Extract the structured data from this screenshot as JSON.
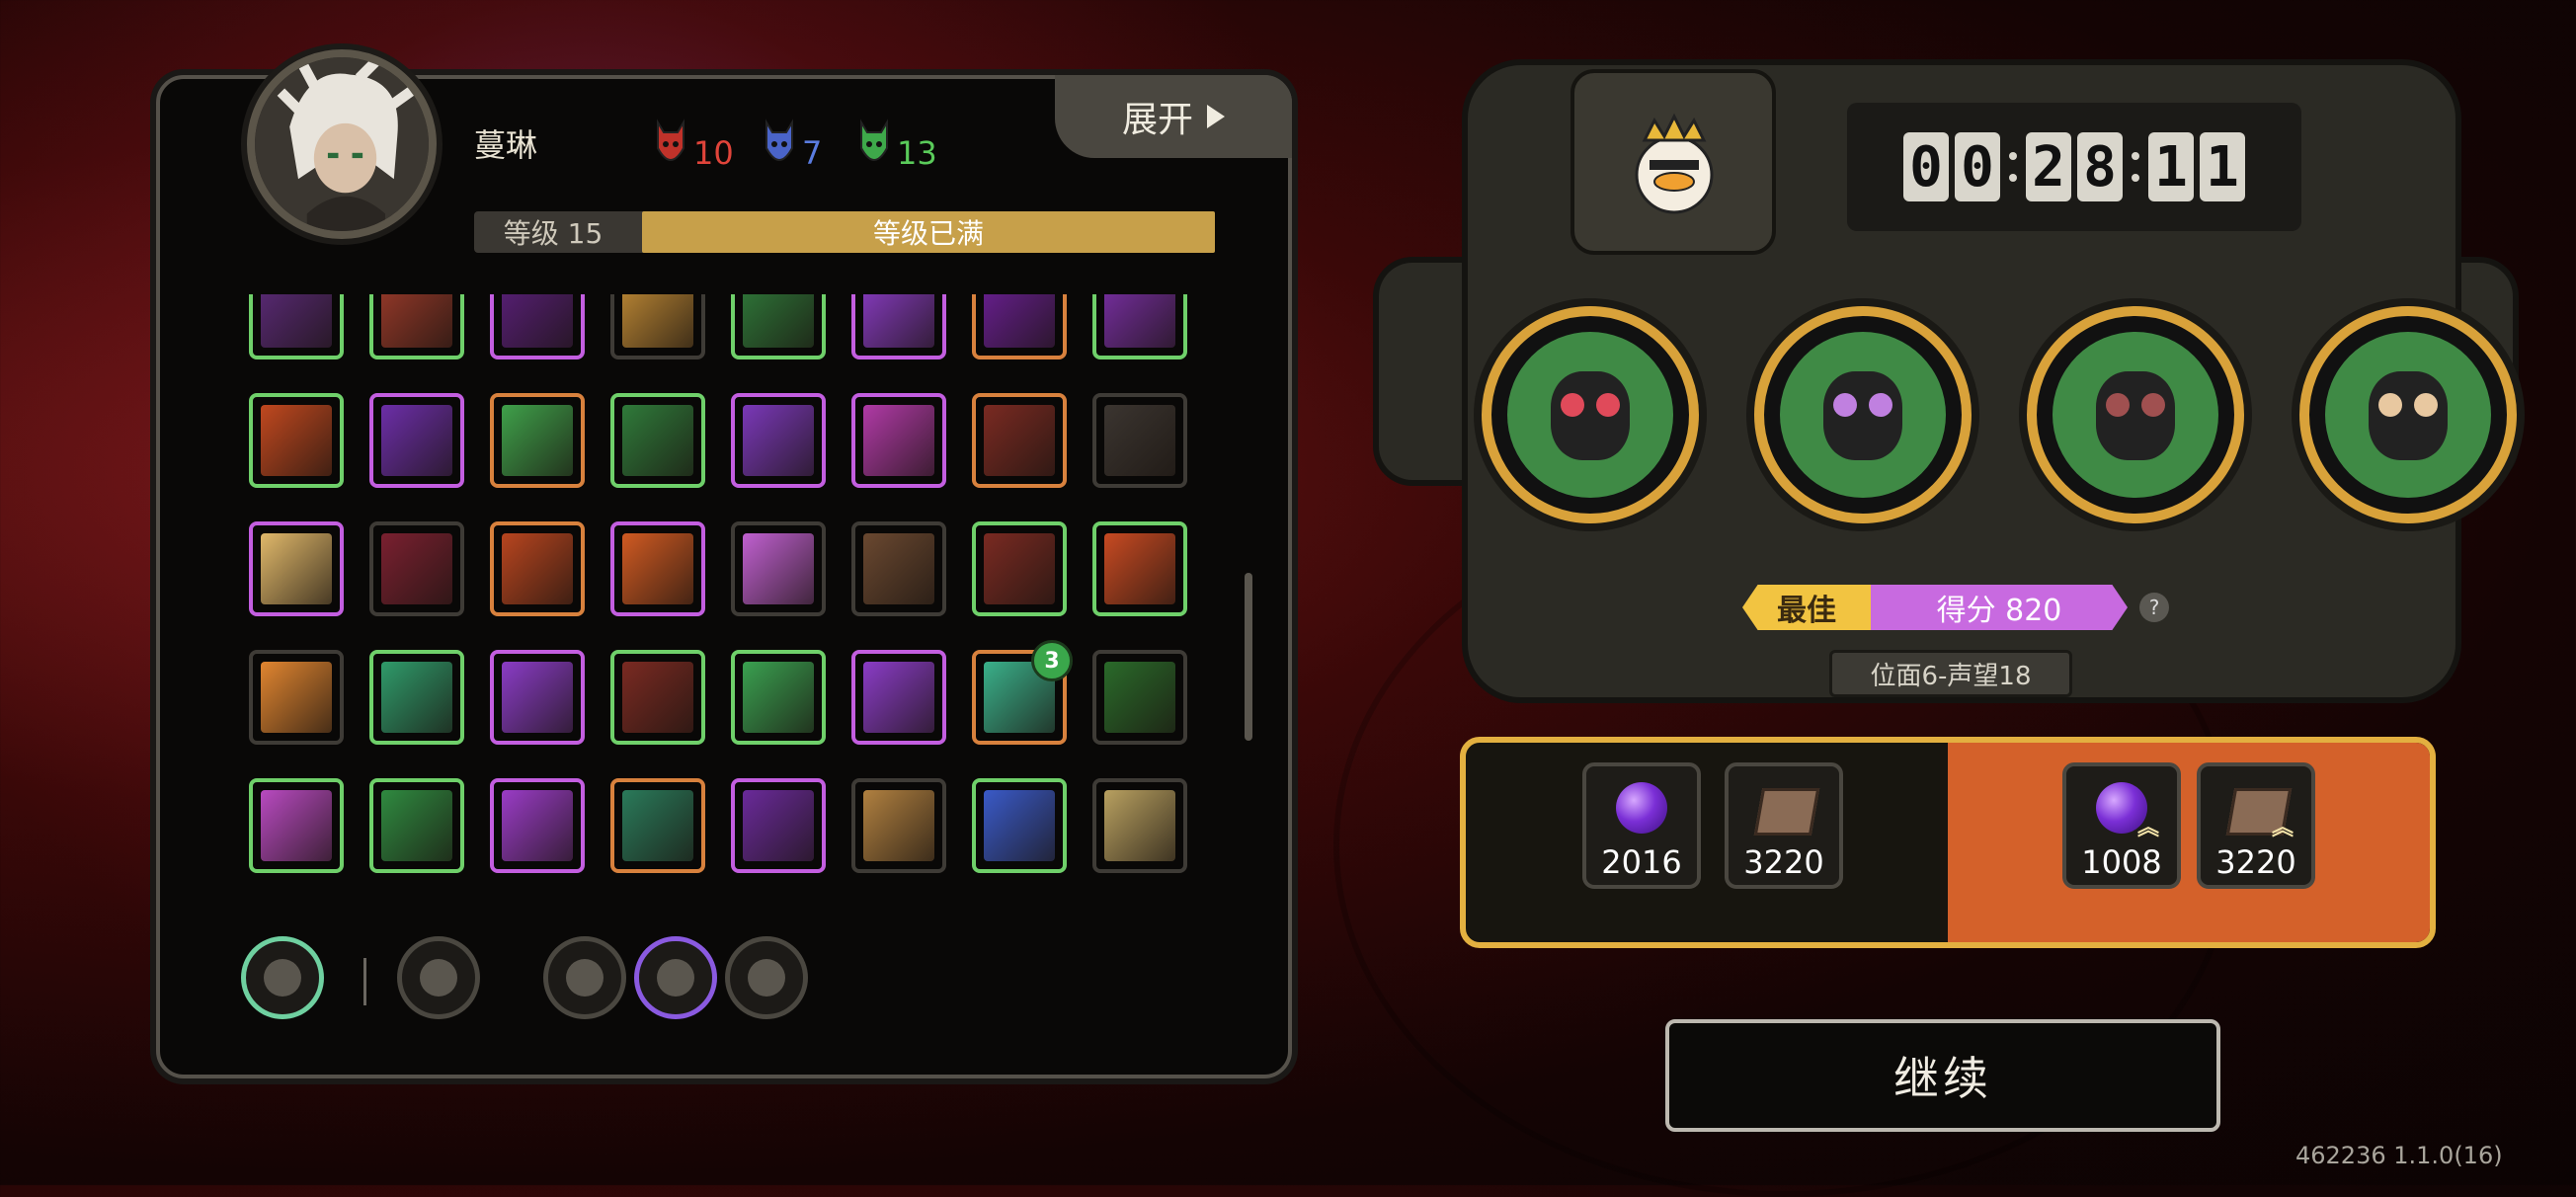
{
  "character": {
    "name": "蔓琳",
    "stats": [
      {
        "value": "10",
        "color": "#e0443a",
        "icon": "red-mask-icon"
      },
      {
        "value": "7",
        "color": "#5a7ce0",
        "icon": "blue-mask-icon"
      },
      {
        "value": "13",
        "color": "#5acb5a",
        "icon": "green-mask-icon"
      }
    ],
    "expand_label": "展开",
    "level_label": "等级 15",
    "level_status": "等级已满"
  },
  "skills": {
    "rows": [
      [
        "g",
        "g",
        "p",
        "k",
        "g",
        "p",
        "o",
        "g"
      ],
      [
        "g",
        "p",
        "o",
        "g",
        "p",
        "p",
        "o",
        "k"
      ],
      [
        "p",
        "k",
        "o",
        "p",
        "k",
        "k",
        "g",
        "g"
      ],
      [
        "k",
        "g",
        "p",
        "g",
        "g",
        "p",
        "o",
        "k"
      ],
      [
        "g",
        "g",
        "p",
        "o",
        "p",
        "k",
        "g",
        "k"
      ]
    ],
    "inner_colors": [
      [
        "#5c2a7a",
        "#9a3a2a",
        "#5a1f7a",
        "#c08a35",
        "#2f7a3a",
        "#8a3cc6",
        "#6b1f95",
        "#7a2fa6"
      ],
      [
        "#c0481f",
        "#6c2ea8",
        "#3fa04a",
        "#2f7a3a",
        "#7a38b8",
        "#b03aa6",
        "#7a2a22",
        "#3b3530"
      ],
      [
        "#e0b86a",
        "#7a2030",
        "#b8451f",
        "#d05a22",
        "#c060d0",
        "#6a4830",
        "#7a2a22",
        "#c84a22"
      ],
      [
        "#e08530",
        "#2f9a6a",
        "#8a3cc6",
        "#7a2a22",
        "#3aa050",
        "#8a3cc6",
        "#3ab08a",
        "#2a6a2a"
      ],
      [
        "#b84ac0",
        "#2f8a40",
        "#9a3cc6",
        "#2a7a5a",
        "#6a2a9a",
        "#b08040",
        "#3a5ac8",
        "#b8a060"
      ]
    ],
    "badge_value": "3"
  },
  "bottom_items": [
    {
      "name": "compass-item",
      "border": "#6fd0a0"
    },
    {
      "name": "scroll-item",
      "border": "#4a4740"
    },
    {
      "name": "triangle-item",
      "border": "#4a4740"
    },
    {
      "name": "heart-item",
      "border": "#8a5ae0"
    },
    {
      "name": "receipt-item",
      "border": "#4a4740"
    }
  ],
  "timer": {
    "hh": [
      "0",
      "0"
    ],
    "mm": [
      "2",
      "8"
    ],
    "ss": [
      "1",
      "1"
    ]
  },
  "companions": [
    {
      "name": "bug-companion",
      "accent": "#e04a5a"
    },
    {
      "name": "crowned-demon-companion",
      "accent": "#c080e0"
    },
    {
      "name": "hooded-companion",
      "accent": "#a05050"
    },
    {
      "name": "glasses-companion",
      "accent": "#e8c8a0"
    }
  ],
  "score": {
    "best_label": "最佳",
    "score_label": "得分 820",
    "help": "?"
  },
  "plane_label": "位面6-声望18",
  "rewards": {
    "base": [
      {
        "type": "orb",
        "value": "2016"
      },
      {
        "type": "book",
        "value": "3220"
      }
    ],
    "bonus": [
      {
        "type": "orb",
        "value": "1008"
      },
      {
        "type": "book",
        "value": "3220"
      }
    ],
    "bonus_chevron": "︽"
  },
  "continue_label": "继续",
  "version": "462236 1.1.0(16)"
}
